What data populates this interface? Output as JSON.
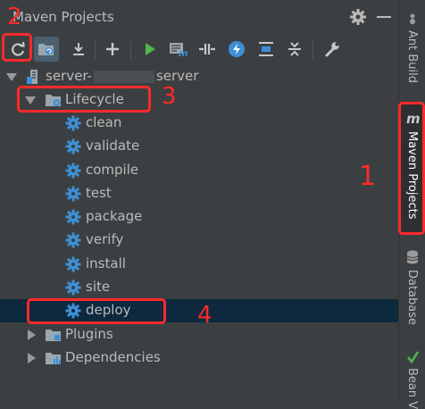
{
  "panel": {
    "title": "Maven Projects"
  },
  "toolbar": {
    "buttons": [
      "reimport",
      "generate-sources",
      "download",
      "add",
      "run",
      "execute-goal",
      "toggle-offline",
      "skip-tests",
      "show-dependencies",
      "collapse-all",
      "settings"
    ]
  },
  "tree": {
    "project": {
      "prefix": "server-",
      "suffix": "server"
    },
    "lifecycle": {
      "label": "Lifecycle",
      "goals": [
        "clean",
        "validate",
        "compile",
        "test",
        "package",
        "verify",
        "install",
        "site",
        "deploy"
      ]
    },
    "selected_goal": "deploy",
    "plugins": {
      "label": "Plugins"
    },
    "dependencies": {
      "label": "Dependencies"
    }
  },
  "annotations": {
    "n1": "1",
    "n2": "2",
    "n3": "3",
    "n4": "4"
  },
  "side_tabs": {
    "ant": "Ant Build",
    "maven": "Maven Projects",
    "database": "Database",
    "bean": "Bean V"
  },
  "colors": {
    "background": "#3c3f41",
    "selection": "#0d293e",
    "annotation": "#ff2a2a",
    "gear_blue": "#3d8fd6",
    "run_green": "#4eb84a"
  }
}
